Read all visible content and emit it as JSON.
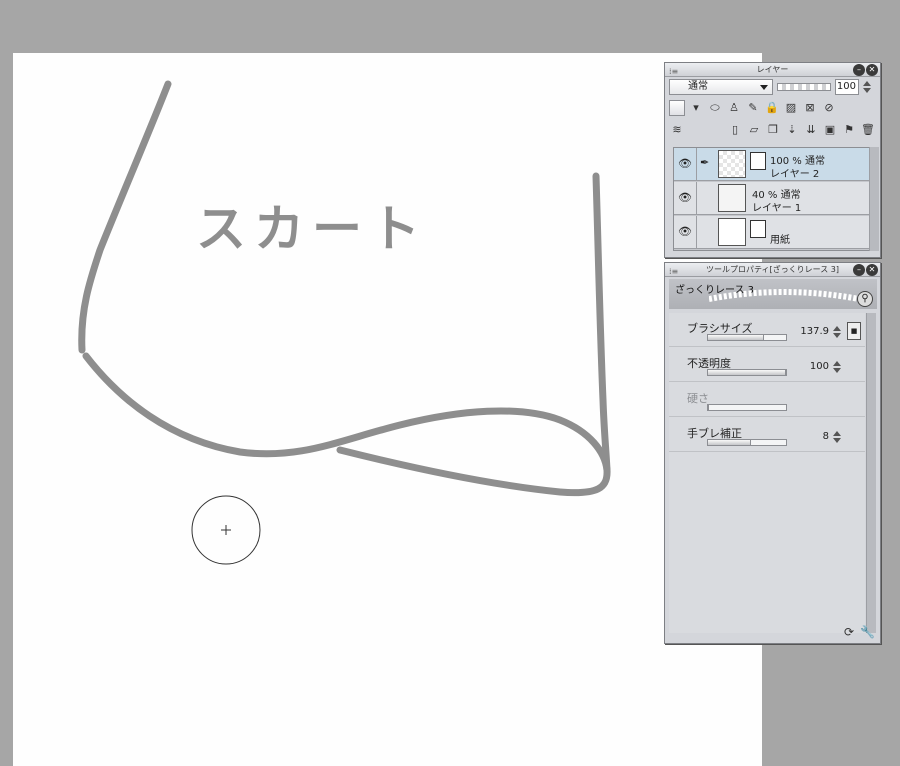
{
  "canvas": {
    "sketch_text": "スカート"
  },
  "layer_panel": {
    "title": "レイヤー",
    "blend_mode": "通常",
    "opacity": "100",
    "layers": [
      {
        "info": "100 % 通常",
        "name": "レイヤー 2",
        "selected": true
      },
      {
        "info": "40 % 通常",
        "name": "レイヤー 1",
        "selected": false
      },
      {
        "info": "",
        "name": "用紙",
        "selected": false
      }
    ]
  },
  "tool_panel": {
    "title": "ツールプロパティ[ざっくりレース 3]",
    "preset_name": "ざっくりレース 3",
    "properties": {
      "brush_size": {
        "label": "ブラシサイズ",
        "value": "137.9",
        "fill": 0.72
      },
      "opacity": {
        "label": "不透明度",
        "value": "100",
        "fill": 1.0
      },
      "hardness": {
        "label": "硬さ",
        "value": "",
        "fill": 0.0
      },
      "stabilization": {
        "label": "手ブレ補正",
        "value": "8",
        "fill": 0.55
      }
    },
    "size_button": "■"
  },
  "colors": {
    "canvas_bg": "#a6a6a6",
    "paper": "#fefefe",
    "stroke": "#8e8e8e",
    "panel": "#d4d6db",
    "selected_layer": "#c9dbe8"
  },
  "icons": {
    "eye": "eye-icon",
    "pen": "pen-icon",
    "close": "close-icon",
    "minimize": "minimize-icon",
    "zoom": "magnifier-icon",
    "settings": "wrench-icon",
    "reset": "reset-icon"
  }
}
